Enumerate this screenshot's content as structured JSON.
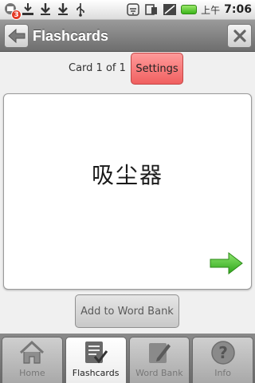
{
  "status_bar": {
    "notification_count": "3",
    "time_prefix": "上午",
    "time": "7:06"
  },
  "title_bar": {
    "title": "Flashcards"
  },
  "card_header": {
    "card_count": "Card 1 of 1",
    "settings_label": "Settings"
  },
  "card": {
    "word": "吸尘器"
  },
  "actions": {
    "add_to_word_bank_label": "Add to Word Bank"
  },
  "tabs": [
    {
      "label": "Home",
      "icon": "home-icon"
    },
    {
      "label": "Flashcards",
      "icon": "flashcards-icon"
    },
    {
      "label": "Word Bank",
      "icon": "word-bank-icon"
    },
    {
      "label": "Info",
      "icon": "info-icon"
    }
  ],
  "colors": {
    "settings_button": "#f06060",
    "arrow_green": "#3fbf2a"
  }
}
